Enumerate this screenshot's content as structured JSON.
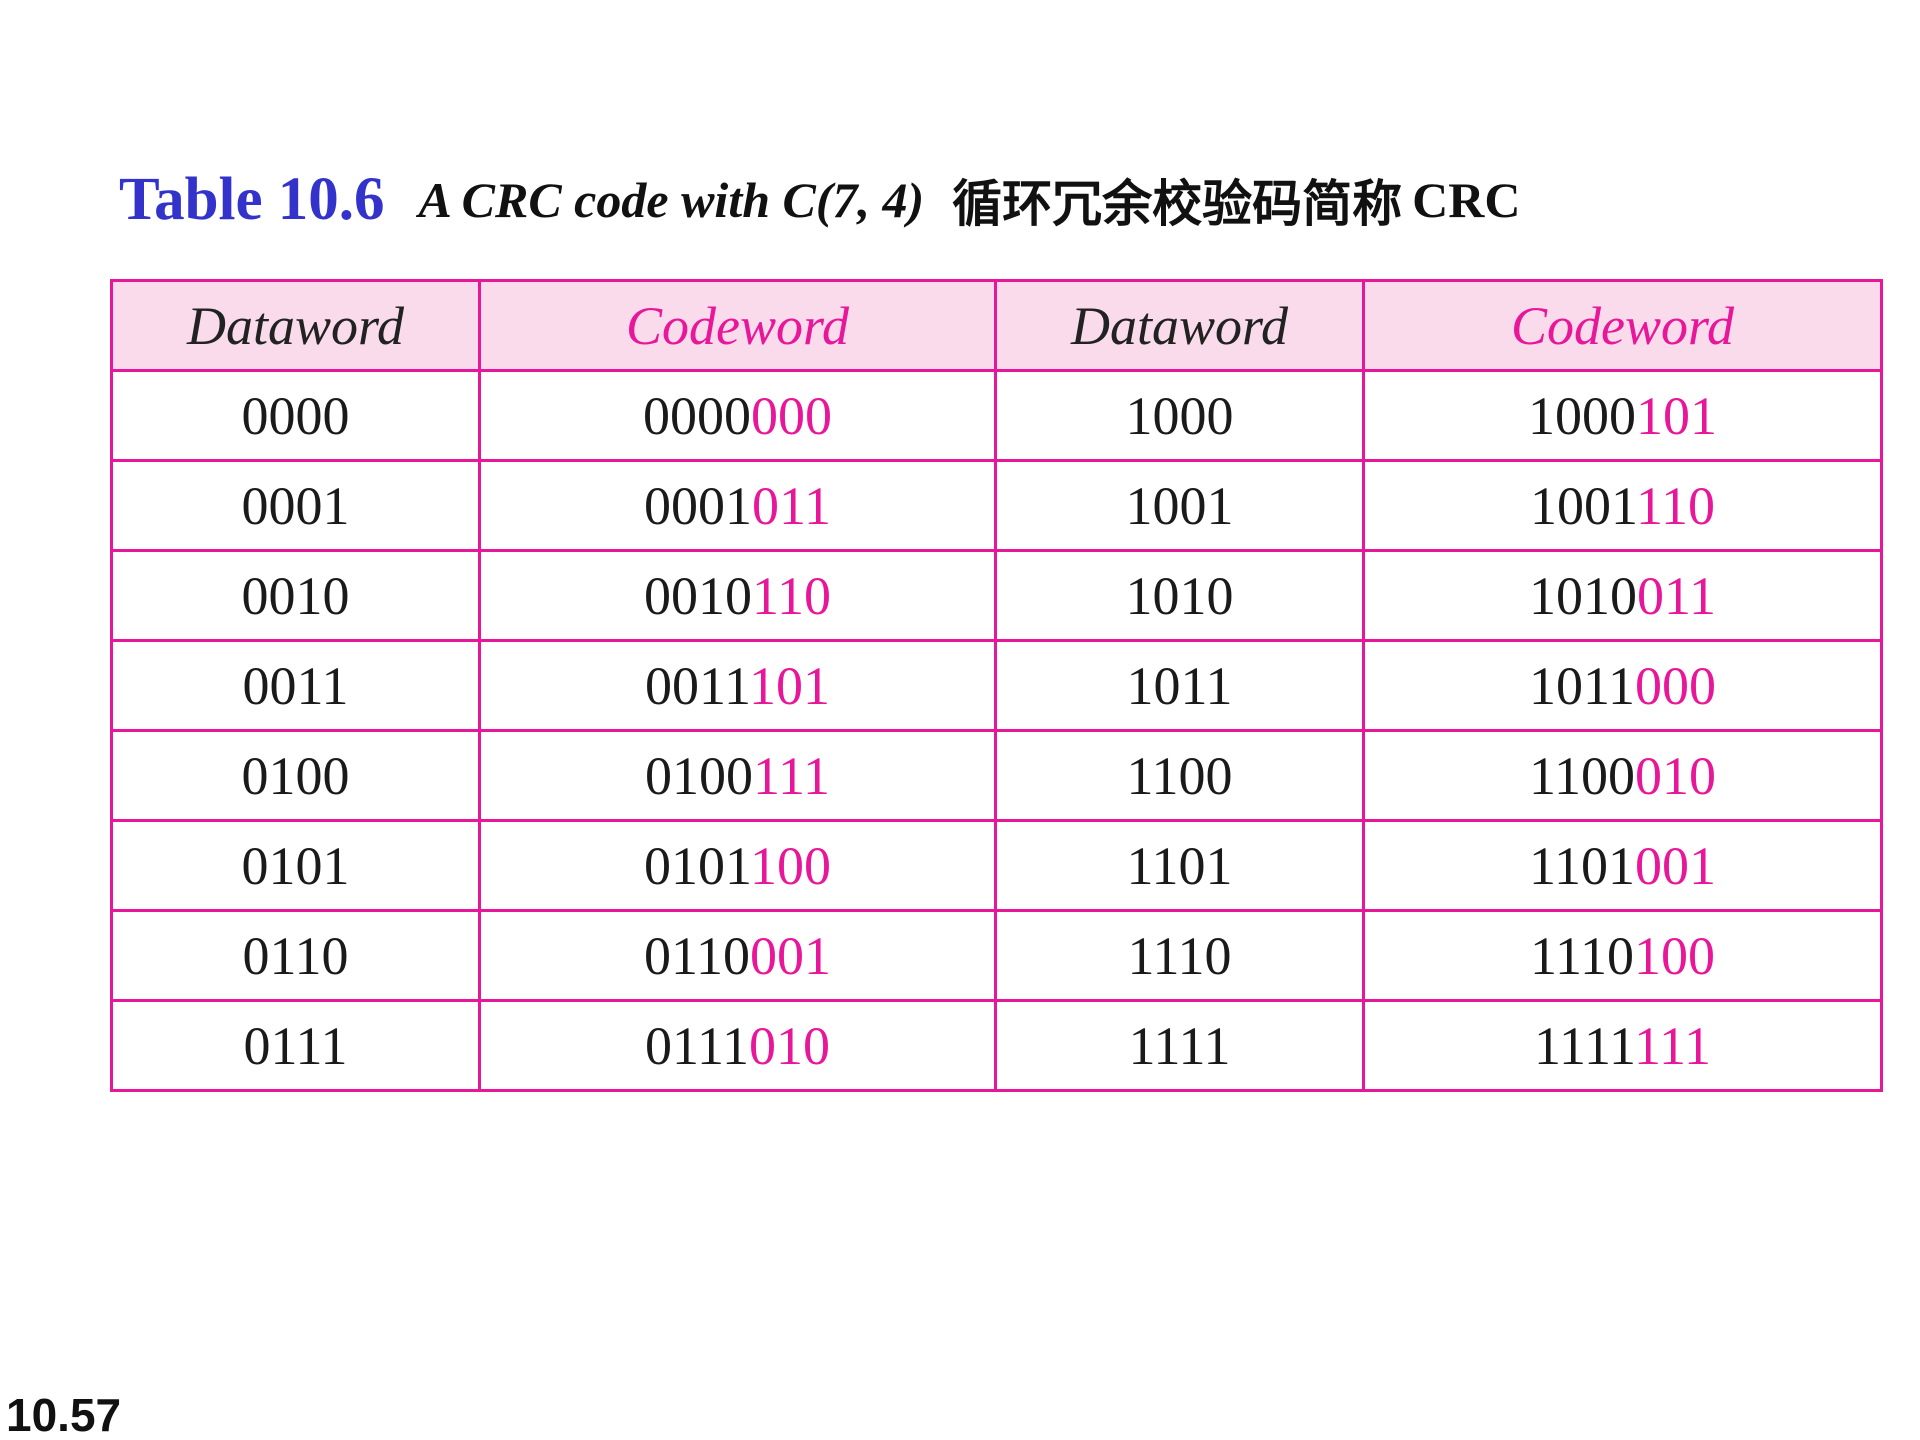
{
  "title": {
    "table_label": "Table 10.6",
    "caption": "A CRC code with C(7, 4)",
    "caption_cn": "循环冗余校验码简称",
    "caption_crc": "CRC"
  },
  "table": {
    "headers": [
      "Dataword",
      "Codeword",
      "Dataword",
      "Codeword"
    ],
    "rows": [
      {
        "d1": "0000",
        "c1_data": "0000",
        "c1_check": "000",
        "d2": "1000",
        "c2_data": "1000",
        "c2_check": "101"
      },
      {
        "d1": "0001",
        "c1_data": "0001",
        "c1_check": "011",
        "d2": "1001",
        "c2_data": "1001",
        "c2_check": "110"
      },
      {
        "d1": "0010",
        "c1_data": "0010",
        "c1_check": "110",
        "d2": "1010",
        "c2_data": "1010",
        "c2_check": "011"
      },
      {
        "d1": "0011",
        "c1_data": "0011",
        "c1_check": "101",
        "d2": "1011",
        "c2_data": "1011",
        "c2_check": "000"
      },
      {
        "d1": "0100",
        "c1_data": "0100",
        "c1_check": "111",
        "d2": "1100",
        "c2_data": "1100",
        "c2_check": "010"
      },
      {
        "d1": "0101",
        "c1_data": "0101",
        "c1_check": "100",
        "d2": "1101",
        "c2_data": "1101",
        "c2_check": "001"
      },
      {
        "d1": "0110",
        "c1_data": "0110",
        "c1_check": "001",
        "d2": "1110",
        "c2_data": "1110",
        "c2_check": "100"
      },
      {
        "d1": "0111",
        "c1_data": "0111",
        "c1_check": "010",
        "d2": "1111",
        "c2_data": "1111",
        "c2_check": "111"
      }
    ]
  },
  "slide_number": "10.57",
  "colors": {
    "title_blue": "#3333cc",
    "accent_magenta": "#e8179a",
    "header_fill": "#fadbeb"
  }
}
